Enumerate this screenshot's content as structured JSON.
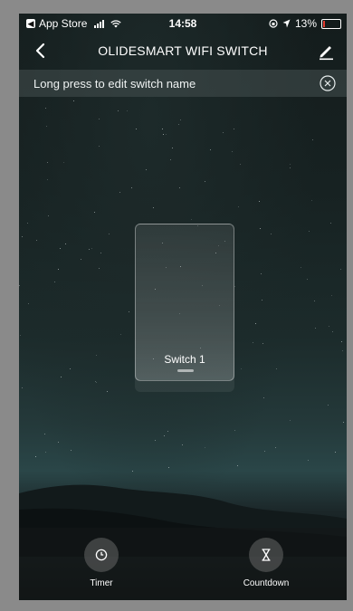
{
  "status_bar": {
    "carrier": "App Store",
    "time": "14:58",
    "battery_percent": "13%",
    "battery_level": 0.13,
    "battery_color": "#e53b2f"
  },
  "nav": {
    "title": "OLIDESMART WIFI SWITCH",
    "back_icon": "chevron-left-icon",
    "edit_icon": "pencil-icon"
  },
  "hint": {
    "text": "Long press to edit switch name",
    "close_icon": "close-circle-icon"
  },
  "switch": {
    "label": "Switch 1"
  },
  "actions": [
    {
      "label": "Timer",
      "icon": "clock-icon"
    },
    {
      "label": "Countdown",
      "icon": "hourglass-icon"
    }
  ]
}
